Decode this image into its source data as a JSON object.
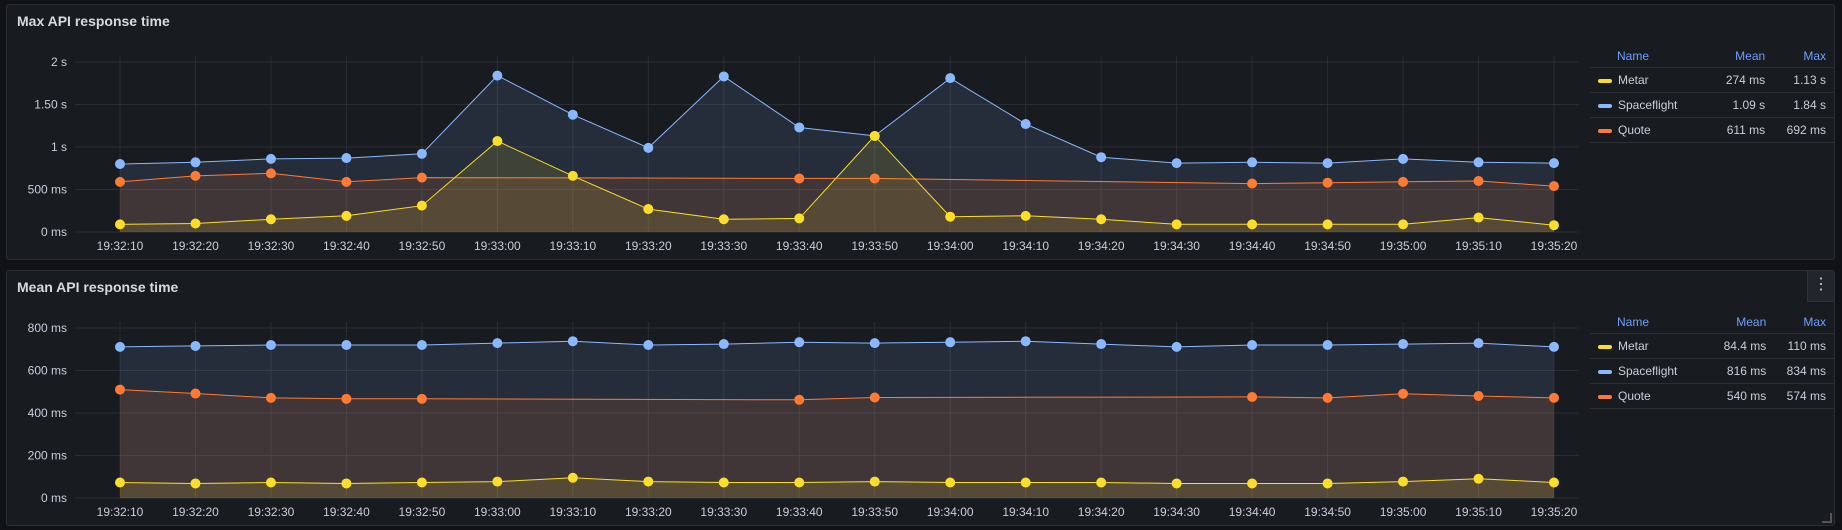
{
  "panels": [
    {
      "title": "Max API response time",
      "legend": {
        "headers": [
          "Name",
          "Mean",
          "Max"
        ],
        "rows": [
          {
            "name": "Metar",
            "mean": "274 ms",
            "max": "1.13 s",
            "color": "#fade2a"
          },
          {
            "name": "Spaceflight",
            "mean": "1.09 s",
            "max": "1.84 s",
            "color": "#8ab8ff"
          },
          {
            "name": "Quote",
            "mean": "611 ms",
            "max": "692 ms",
            "color": "#ff7a33"
          }
        ]
      }
    },
    {
      "title": "Mean API response time",
      "menu_icon": "kebab-menu-icon",
      "legend": {
        "headers": [
          "Name",
          "Mean",
          "Max"
        ],
        "rows": [
          {
            "name": "Metar",
            "mean": "84.4 ms",
            "max": "110 ms",
            "color": "#fade2a"
          },
          {
            "name": "Spaceflight",
            "mean": "816 ms",
            "max": "834 ms",
            "color": "#8ab8ff"
          },
          {
            "name": "Quote",
            "mean": "540 ms",
            "max": "574 ms",
            "color": "#ff7a33"
          }
        ]
      }
    }
  ],
  "chart_data": [
    {
      "type": "line",
      "title": "Max API response time",
      "x": [
        "19:32:10",
        "19:32:20",
        "19:32:30",
        "19:32:40",
        "19:32:50",
        "19:33:00",
        "19:33:10",
        "19:33:20",
        "19:33:30",
        "19:33:40",
        "19:33:50",
        "19:34:00",
        "19:34:10",
        "19:34:20",
        "19:34:30",
        "19:34:40",
        "19:34:50",
        "19:35:00",
        "19:35:10",
        "19:35:20"
      ],
      "yticks": [
        "0 ms",
        "500 ms",
        "1 s",
        "1.50 s",
        "2 s"
      ],
      "ylim": [
        0,
        2000
      ],
      "yunit": "ms",
      "grid": true,
      "legend_position": "right",
      "series": [
        {
          "name": "Spaceflight",
          "color": "#8ab8ff",
          "values": [
            800,
            820,
            860,
            870,
            920,
            1840,
            1380,
            990,
            1830,
            1230,
            1130,
            1810,
            1270,
            880,
            810,
            820,
            810,
            860,
            820,
            810
          ],
          "points": [
            0,
            1,
            2,
            3,
            4,
            5,
            6,
            7,
            8,
            9,
            10,
            11,
            12,
            13,
            14,
            15,
            16,
            17,
            18,
            19
          ]
        },
        {
          "name": "Quote",
          "color": "#ff7a33",
          "values": [
            590,
            660,
            690,
            590,
            640,
            null,
            null,
            null,
            null,
            630,
            630,
            null,
            null,
            null,
            null,
            570,
            580,
            590,
            600,
            540
          ],
          "points": [
            0,
            1,
            2,
            3,
            4,
            9,
            10,
            15,
            16,
            17,
            18,
            19
          ]
        },
        {
          "name": "Metar",
          "color": "#fade2a",
          "values": [
            90,
            100,
            150,
            190,
            310,
            1070,
            660,
            270,
            150,
            160,
            1130,
            180,
            190,
            150,
            90,
            90,
            90,
            90,
            170,
            80
          ],
          "points": [
            0,
            1,
            2,
            3,
            4,
            5,
            6,
            7,
            8,
            9,
            10,
            11,
            12,
            13,
            14,
            15,
            16,
            17,
            18,
            19
          ]
        }
      ]
    },
    {
      "type": "line",
      "title": "Mean API response time",
      "x": [
        "19:32:10",
        "19:32:20",
        "19:32:30",
        "19:32:40",
        "19:32:50",
        "19:33:00",
        "19:33:10",
        "19:33:20",
        "19:33:30",
        "19:33:40",
        "19:33:50",
        "19:34:00",
        "19:34:10",
        "19:34:20",
        "19:34:30",
        "19:34:40",
        "19:34:50",
        "19:35:00",
        "19:35:10",
        "19:35:20"
      ],
      "yticks": [
        "0 ms",
        "200 ms",
        "400 ms",
        "600 ms",
        "800 ms"
      ],
      "ylim": [
        0,
        900
      ],
      "yunit": "ms",
      "grid": true,
      "legend_position": "right",
      "series": [
        {
          "name": "Spaceflight",
          "color": "#8ab8ff",
          "values": [
            800,
            805,
            810,
            810,
            810,
            820,
            830,
            810,
            815,
            825,
            820,
            825,
            830,
            815,
            800,
            810,
            810,
            815,
            820,
            800
          ],
          "points": [
            0,
            1,
            2,
            3,
            4,
            5,
            6,
            7,
            8,
            9,
            10,
            11,
            12,
            13,
            14,
            15,
            16,
            17,
            18,
            19
          ]
        },
        {
          "name": "Quote",
          "color": "#ff7a33",
          "values": [
            574,
            553,
            530,
            525,
            525,
            null,
            null,
            null,
            null,
            520,
            532,
            null,
            null,
            null,
            null,
            535,
            530,
            552,
            540,
            530
          ],
          "points": [
            0,
            1,
            2,
            3,
            4,
            9,
            10,
            15,
            16,
            17,
            18,
            19
          ]
        },
        {
          "name": "Metar",
          "color": "#fade2a",
          "values": [
            82,
            77,
            82,
            77,
            82,
            87,
            107,
            87,
            82,
            82,
            87,
            82,
            82,
            82,
            77,
            77,
            77,
            87,
            102,
            82
          ],
          "points": [
            0,
            1,
            2,
            3,
            4,
            5,
            6,
            7,
            8,
            9,
            10,
            11,
            12,
            13,
            14,
            15,
            16,
            17,
            18,
            19
          ]
        }
      ]
    }
  ]
}
